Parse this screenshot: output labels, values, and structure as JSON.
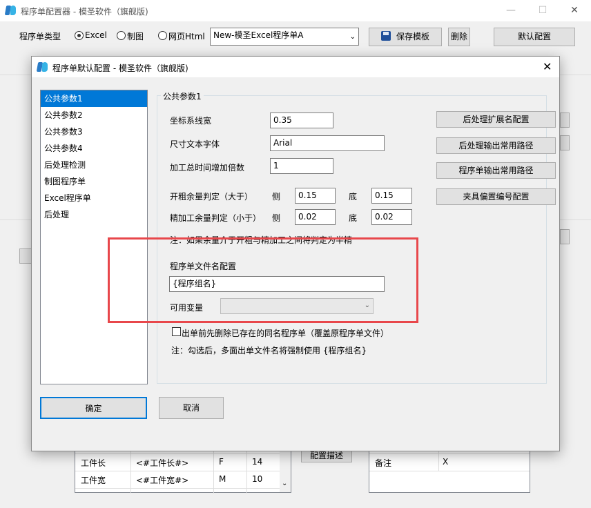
{
  "app": {
    "title": "程序单配置器 - 模圣软件（旗舰版)",
    "window_controls": {
      "minimize": "—",
      "maximize": "☐",
      "close": "✕"
    }
  },
  "toolbar": {
    "type_label": "程序单类型",
    "radio_excel": "Excel",
    "radio_drawing": "制图",
    "radio_web": "网页Html",
    "template_selected": "New-模圣Excel程序单A",
    "save_template": "保存模板",
    "delete": "删除",
    "default_config": "默认配置"
  },
  "background": {
    "rows": [
      {
        "name": "工件长",
        "var": "<#工件长#>",
        "code": "F",
        "value": "14"
      },
      {
        "name": "工件宽",
        "var": "<#工件宽#>",
        "code": "M",
        "value": "10"
      }
    ],
    "config_desc_button": "配置描述",
    "note_label": "备注",
    "note_value": "X"
  },
  "dialog": {
    "title": "程序单默认配置 - 模圣软件（旗舰版)",
    "close": "✕",
    "nav_items": [
      "公共参数1",
      "公共参数2",
      "公共参数3",
      "公共参数4",
      "后处理检测",
      "制图程序单",
      "Excel程序单",
      "后处理"
    ],
    "group_title": "公共参数1",
    "fields": {
      "coord_width_label": "坐标系线宽",
      "coord_width_value": "0.35",
      "dim_font_label": "尺寸文本字体",
      "dim_font_value": "Arial",
      "time_factor_label": "加工总时间增加倍数",
      "time_factor_value": "1",
      "rough_label": "开粗余量判定（大于）",
      "rough_side_label": "侧",
      "rough_side_value": "0.15",
      "rough_bottom_label": "底",
      "rough_bottom_value": "0.15",
      "finish_label": "精加工余量判定（小于）",
      "finish_side_label": "侧",
      "finish_side_value": "0.02",
      "finish_bottom_label": "底",
      "finish_bottom_value": "0.02",
      "note1": "注：如果余量介于开粗与精加工之间将判定为半精",
      "filename_label": "程序单文件名配置",
      "filename_value": "{程序组名}",
      "variables_label": "可用变量",
      "variables_value": "",
      "delete_checkbox_label": "出单前先删除已存在的同名程序单（覆盖原程序单文件）",
      "note2": "注：勾选后，多面出单文件名将强制使用 {程序组名}"
    },
    "side_buttons": [
      "后处理扩展名配置",
      "后处理输出常用路径",
      "程序单输出常用路径",
      "夹具偏置编号配置"
    ],
    "ok": "确定",
    "cancel": "取消"
  },
  "colors": {
    "selection": "#0078d7",
    "highlight": "#e8474b"
  }
}
